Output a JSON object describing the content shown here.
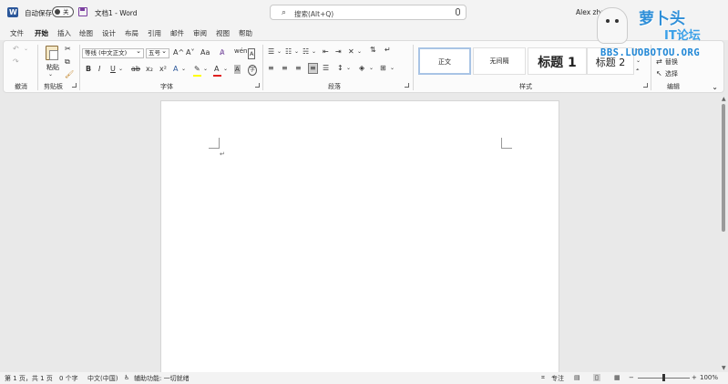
{
  "titlebar": {
    "autosave_label": "自动保存",
    "autosave_state": "关",
    "doc_title": "文档1  -  Word",
    "search_placeholder": "搜索(Alt+Q)",
    "user_name": "Alex zha"
  },
  "watermark": {
    "line1": "萝卜头",
    "line2": "IT论坛",
    "line3": "BBS.LUOBOTOU.ORG"
  },
  "menu": {
    "tabs": [
      "文件",
      "开始",
      "插入",
      "绘图",
      "设计",
      "布局",
      "引用",
      "邮件",
      "审阅",
      "视图",
      "帮助"
    ],
    "active_index": 1
  },
  "ribbon": {
    "groups": {
      "undo": "撤消",
      "clipboard": "剪贴板",
      "font": "字体",
      "paragraph": "段落",
      "styles": "样式",
      "editing": "编辑"
    },
    "paste_label": "粘贴",
    "font_name": "等线 (中文正文)",
    "font_size": "五号",
    "font_grow": "A^",
    "font_shrink": "A˅",
    "change_case": "Aa",
    "bold": "B",
    "italic": "I",
    "underline": "U",
    "strikethrough": "ab",
    "subscript": "x₂",
    "superscript": "x²",
    "styles": [
      "正文",
      "无间隔",
      "标题 1",
      "标题 2"
    ],
    "replace_label": "替换",
    "select_label": "选择"
  },
  "statusbar": {
    "page": "第 1 页，共 1 页",
    "words": "0 个字",
    "language": "中文(中国)",
    "accessibility": "辅助功能: 一切就绪",
    "focus": "专注",
    "zoom": "100%"
  },
  "colors": {
    "accent": "#2b579a",
    "highlight": "#ffff00",
    "font_color": "#e02020"
  }
}
